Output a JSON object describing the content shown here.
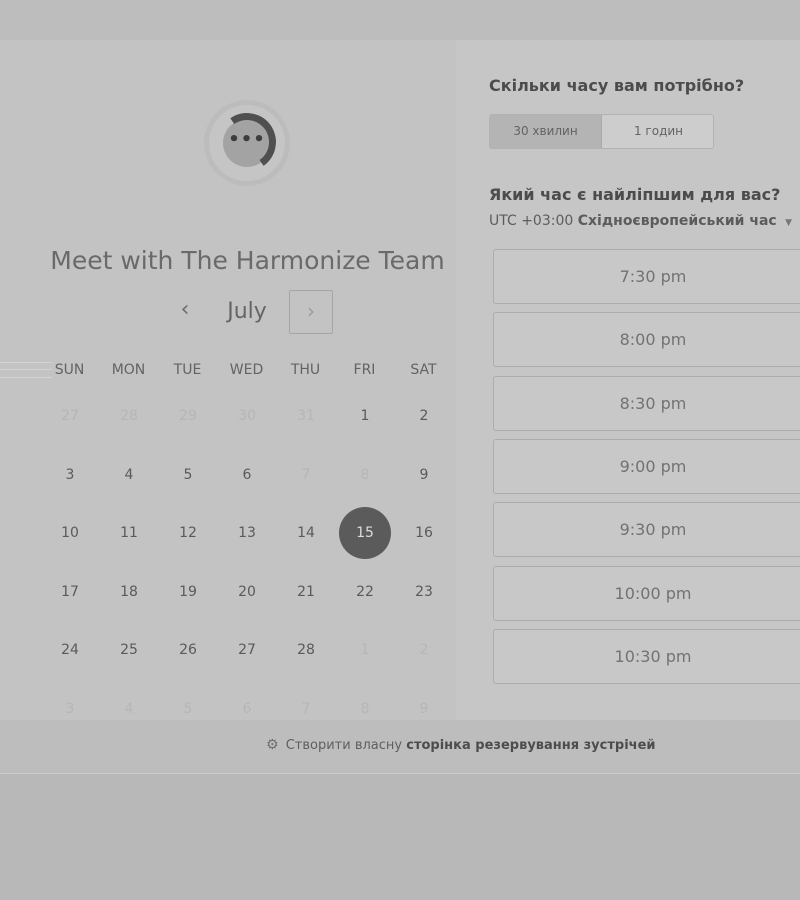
{
  "header": {
    "title": "Meet with The Harmonize Team",
    "logo_icon": "chat-bubble-dots-icon",
    "logo_dots": "•••"
  },
  "calendar": {
    "month": "July",
    "prev_glyph": "‹",
    "next_glyph": "›",
    "weekdays": [
      "SUN",
      "MON",
      "TUE",
      "WED",
      "THU",
      "FRI",
      "SAT"
    ],
    "weeks": [
      [
        "27",
        "28",
        "29",
        "30",
        "31",
        "1",
        "2"
      ],
      [
        "3",
        "4",
        "5",
        "6",
        "7",
        "8",
        "9"
      ],
      [
        "10",
        "11",
        "12",
        "13",
        "14",
        "15",
        "16"
      ],
      [
        "17",
        "18",
        "19",
        "20",
        "21",
        "22",
        "23"
      ],
      [
        "24",
        "25",
        "26",
        "27",
        "28",
        "1",
        "2"
      ],
      [
        "3",
        "4",
        "5",
        "6",
        "7",
        "8",
        "9"
      ]
    ],
    "selected_day": "15"
  },
  "booking": {
    "duration_question": "Скільки часу вам потрібно?",
    "durations": [
      "30 хвилин",
      "1 годин"
    ],
    "active_duration": "30 хвилин",
    "time_question": "Який час є найліпшим для вас?",
    "timezone_offset": "UTC +03:00",
    "timezone_name": "Східноєвропейський час",
    "timezone_caret": "▼",
    "slots": [
      "7:30 pm",
      "8:00 pm",
      "8:30 pm",
      "9:00 pm",
      "9:30 pm",
      "10:00 pm",
      "10:30 pm"
    ]
  },
  "footer": {
    "icon": "sprocket-icon",
    "icon_glyph": "⚙",
    "text": "Створити власну",
    "link": "сторінка резервування зустрічей"
  }
}
